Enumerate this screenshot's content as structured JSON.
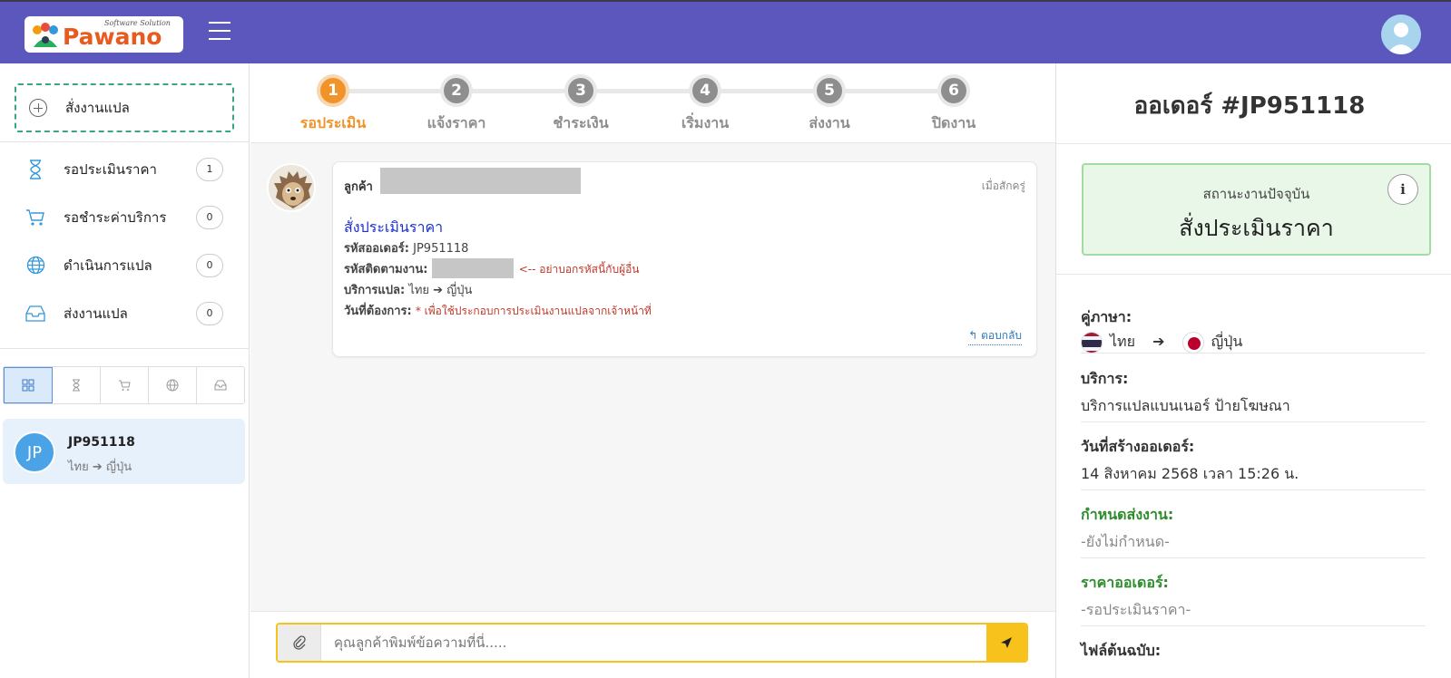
{
  "logo": {
    "word": "Pawano",
    "tagline": "Software Solution"
  },
  "sidebar": {
    "new_order_label": "สั่งงานแปล",
    "items": [
      {
        "label": "รอประเมินราคา",
        "count": "1",
        "icon": "hourglass-icon"
      },
      {
        "label": "รอชำระค่าบริการ",
        "count": "0",
        "icon": "cart-icon"
      },
      {
        "label": "ดำเนินการแปล",
        "count": "0",
        "icon": "globe-icon"
      },
      {
        "label": "ส่งงานแปล",
        "count": "0",
        "icon": "inbox-icon"
      }
    ],
    "filter_tabs": [
      "grid-icon",
      "hourglass-icon",
      "cart-icon",
      "globe-icon",
      "inbox-icon"
    ],
    "order": {
      "avatar": "JP",
      "id": "JP951118",
      "langpair": "ไทย ➔ ญี่ปุ่น"
    }
  },
  "steps": [
    {
      "num": "1",
      "label": "รอประเมิน",
      "active": true
    },
    {
      "num": "2",
      "label": "แจ้งราคา",
      "active": false
    },
    {
      "num": "3",
      "label": "ชำระเงิน",
      "active": false
    },
    {
      "num": "4",
      "label": "เริ่มงาน",
      "active": false
    },
    {
      "num": "5",
      "label": "ส่งงาน",
      "active": false
    },
    {
      "num": "6",
      "label": "ปิดงาน",
      "active": false
    }
  ],
  "message": {
    "sender_label": "ลูกค้า",
    "time": "เมื่อสักครู่",
    "title": "สั่งประเมินราคา",
    "order_code_label": "รหัสออเดอร์:",
    "order_code": "JP951118",
    "tracking_label": "รหัสติดตามงาน:",
    "tracking_warning": "<-- อย่าบอกรหัสนี้กับผู้อื่น",
    "service_label": "บริการแปล:",
    "service_value": "ไทย ➔ ญี่ปุ่น",
    "date_label": "วันที่ต้องการ:",
    "date_value": "* เพื่อใช้ประกอบการประเมินงานแปลจากเจ้าหน้าที่",
    "reply_label": "ตอบกลับ"
  },
  "composer": {
    "placeholder": "คุณลูกค้าพิมพ์ข้อความที่นี่....."
  },
  "order_panel": {
    "title": "ออเดอร์ #JP951118",
    "status_caption": "สถานะงานปัจจุบัน",
    "status_value": "สั่งประเมินราคา",
    "info_label": "i",
    "lang_label": "คู่ภาษา:",
    "lang_from": "ไทย",
    "lang_arrow": "➔",
    "lang_to": "ญี่ปุ่น",
    "service_label": "บริการ:",
    "service_value": "บริการแปลแบนเนอร์ ป้ายโฆษณา",
    "created_label": "วันที่สร้างออเดอร์:",
    "created_value": "14 สิงหาคม 2568 เวลา 15:26 น.",
    "deadline_label": "กำหนดส่งงาน:",
    "deadline_value": "-ยังไม่กำหนด-",
    "price_label": "ราคาออเดอร์:",
    "price_value": "-รอประเมินราคา-",
    "files_label": "ไฟล์ต้นฉบับ:"
  },
  "colors": {
    "header": "#5b57bd",
    "accent_orange": "#f0942a",
    "send_yellow": "#f7c21b",
    "status_green_bg": "#e9f7e9"
  }
}
